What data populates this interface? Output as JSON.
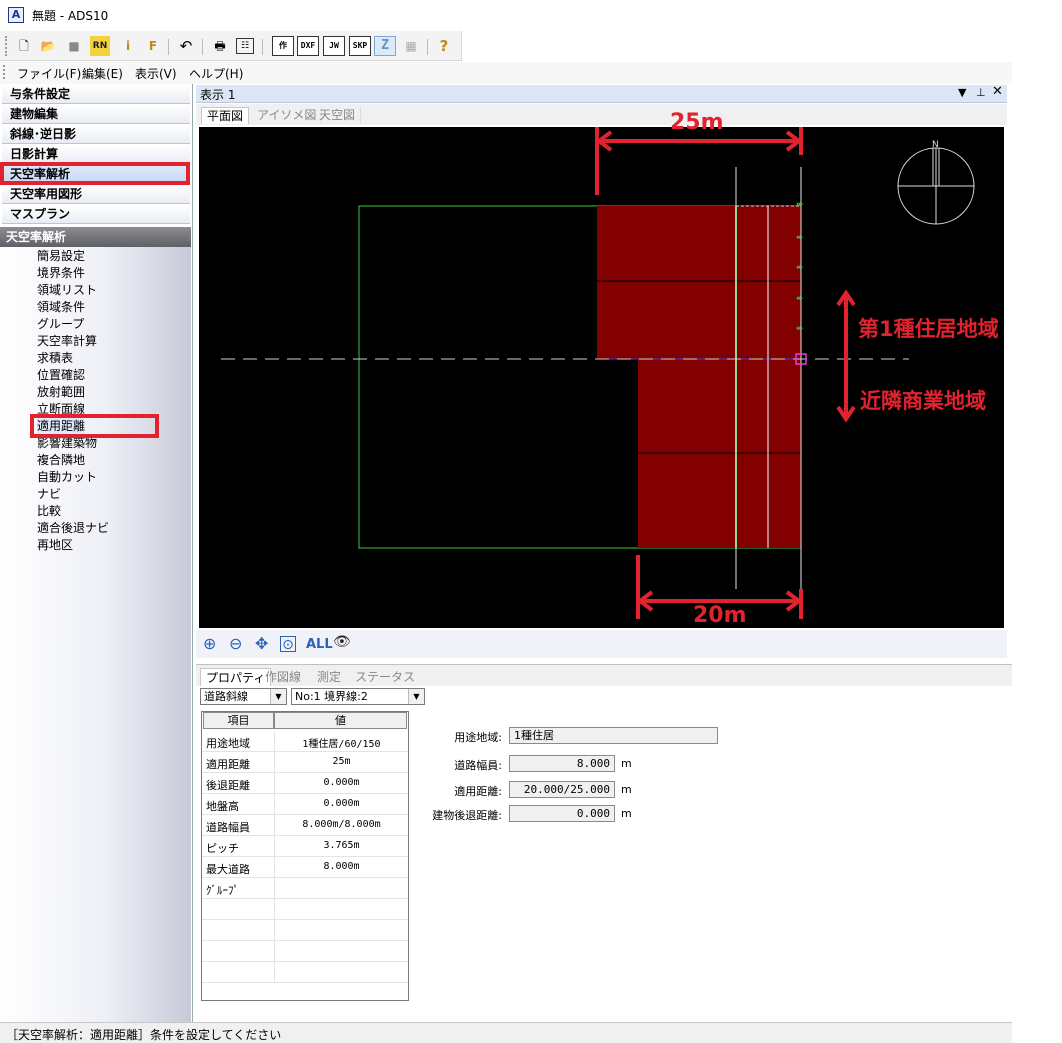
{
  "window": {
    "title": "無題 - ADS10"
  },
  "toolbar": {
    "text_buttons": [
      "作",
      "DXF",
      "JW",
      "SKP",
      "Z"
    ]
  },
  "menu": [
    "ファイル(F)",
    "編集(E)",
    "表示(V)",
    "ヘルプ(H)"
  ],
  "sidebar": {
    "sections": [
      "与条件設定",
      "建物編集",
      "斜線･逆日影",
      "日影計算",
      "天空率解析",
      "天空率用図形",
      "マスプラン"
    ],
    "selected_section": "天空率解析",
    "sub_header": "天空率解析",
    "items": [
      "簡易設定",
      "境界条件",
      "領域リスト",
      "領域条件",
      "グループ",
      "天空率計算",
      "求積表",
      "位置確認",
      "放射範囲",
      "立断面線",
      "適用距離",
      "影響建築物",
      "複合隣地",
      "自動カット",
      "ナビ",
      "比較",
      "適合後退ナビ",
      "再地区"
    ],
    "selected_item": "適用距離"
  },
  "view": {
    "title": "表示 1",
    "tabs": [
      "平面図",
      "アイソメ図",
      "天空図"
    ],
    "active_tab": "平面図",
    "tool_all_label": "ALL"
  },
  "annotations": {
    "top_dim": "25m",
    "bottom_dim": "20m",
    "zone_upper": "第1種住居地域",
    "zone_lower": "近隣商業地域"
  },
  "properties": {
    "tabs": [
      "プロパティ",
      "作図線",
      "測定",
      "ステータス"
    ],
    "active_tab": "プロパティ",
    "type_select": "道路斜線",
    "line_select": "No:1 境界線:2",
    "table_headers": [
      "項目",
      "値"
    ],
    "rows": [
      {
        "k": "用途地域",
        "v": "1種住居/60/150"
      },
      {
        "k": "適用距離",
        "v": "25m"
      },
      {
        "k": "後退距離",
        "v": "0.000m"
      },
      {
        "k": "地盤高",
        "v": "0.000m"
      },
      {
        "k": "道路幅員",
        "v": "8.000m/8.000m"
      },
      {
        "k": "ピッチ",
        "v": "3.765m"
      },
      {
        "k": "最大道路",
        "v": "8.000m"
      },
      {
        "k": "ｸﾞﾙｰﾌﾟ",
        "v": ""
      }
    ],
    "fields": [
      {
        "label": "用途地域:",
        "value": "1種住居",
        "unit": ""
      },
      {
        "label": "道路幅員:",
        "value": "8.000",
        "unit": "m"
      },
      {
        "label": "適用距離:",
        "value": "20.000/25.000",
        "unit": "m"
      },
      {
        "label": "建物後退距離:",
        "value": "0.000",
        "unit": "m"
      }
    ]
  },
  "status": {
    "text": "［天空率解析：適用距離］条件を設定してください"
  },
  "colors": {
    "building": "#820000",
    "site_outline": "#3ccc3c",
    "highlight": "#e0232e",
    "canvas_bg": "#000000"
  }
}
